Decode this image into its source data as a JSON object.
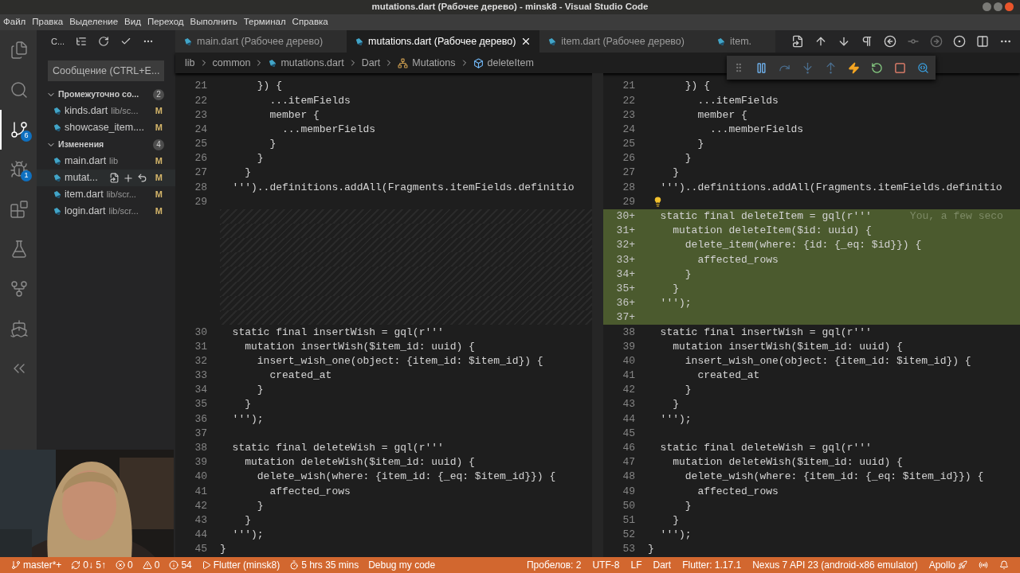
{
  "window": {
    "title": "mutations.dart (Рабочее дерево) - minsk8 - Visual Studio Code"
  },
  "menu": [
    "Файл",
    "Правка",
    "Выделение",
    "Вид",
    "Переход",
    "Выполнить",
    "Терминал",
    "Справка"
  ],
  "activity_bar": [
    {
      "kind": "files",
      "selected": false
    },
    {
      "kind": "search",
      "selected": false
    },
    {
      "kind": "scm",
      "selected": true,
      "badge": "6"
    },
    {
      "kind": "debug",
      "selected": false,
      "badge": "1"
    },
    {
      "kind": "extensions",
      "selected": false
    },
    {
      "kind": "flask",
      "selected": false
    },
    {
      "kind": "graph",
      "selected": false
    },
    {
      "kind": "docker",
      "selected": false
    },
    {
      "kind": "flutter",
      "selected": false
    }
  ],
  "sidebar": {
    "title": "С...",
    "message": {
      "placeholder": "Сообщение (CTRL+E..."
    },
    "groups": [
      {
        "label": "Промежуточно со...",
        "count": "2",
        "expanded": true,
        "files": [
          {
            "name": "kinds.dart",
            "path": "lib/sc...",
            "status": "M",
            "hovered": false
          },
          {
            "name": "showcase_item....",
            "status": "M",
            "hovered": false
          }
        ]
      },
      {
        "label": "Изменения",
        "count": "4",
        "expanded": true,
        "files": [
          {
            "name": "main.dart",
            "path": "lib",
            "status": "M",
            "hovered": false
          },
          {
            "name": "mutat...",
            "status": "M",
            "hovered": true
          },
          {
            "name": "item.dart",
            "path": "lib/scr...",
            "status": "M",
            "hovered": false
          },
          {
            "name": "login.dart",
            "path": "lib/scr...",
            "status": "M",
            "hovered": false
          }
        ]
      }
    ]
  },
  "tabs": [
    {
      "label": "main.dart (Рабочее дерево)",
      "selected": false
    },
    {
      "label": "mutations.dart (Рабочее дерево)",
      "selected": true
    },
    {
      "label": "item.dart (Рабочее дерево)",
      "selected": false
    },
    {
      "label": "item.",
      "selected": false
    }
  ],
  "breadcrumbs": [
    "lib",
    "common",
    "mutations.dart",
    "Dart",
    "Mutations",
    "deleteItem"
  ],
  "left_pane": [
    {
      "kind": "normal",
      "num": "21",
      "text": "      }) {"
    },
    {
      "kind": "normal",
      "num": "22",
      "text": "        ...itemFields"
    },
    {
      "kind": "normal",
      "num": "23",
      "text": "        member {"
    },
    {
      "kind": "normal",
      "num": "24",
      "text": "          ...memberFields"
    },
    {
      "kind": "normal",
      "num": "25",
      "text": "        }"
    },
    {
      "kind": "normal",
      "num": "26",
      "text": "      }"
    },
    {
      "kind": "normal",
      "num": "27",
      "text": "    }"
    },
    {
      "kind": "normal",
      "num": "28",
      "text": "  ''')..definitions.addAll(Fragments.itemFields.definitio"
    },
    {
      "kind": "normal",
      "num": "29"
    },
    {
      "kind": "filler"
    },
    {
      "kind": "filler"
    },
    {
      "kind": "filler"
    },
    {
      "kind": "filler"
    },
    {
      "kind": "filler"
    },
    {
      "kind": "filler"
    },
    {
      "kind": "filler"
    },
    {
      "kind": "filler"
    },
    {
      "kind": "normal",
      "num": "30",
      "text": "  static final insertWish = gql(r'''"
    },
    {
      "kind": "normal",
      "num": "31",
      "text": "    mutation insertWish($item_id: uuid) {"
    },
    {
      "kind": "normal",
      "num": "32",
      "text": "      insert_wish_one(object: {item_id: $item_id}) {"
    },
    {
      "kind": "normal",
      "num": "33",
      "text": "        created_at"
    },
    {
      "kind": "normal",
      "num": "34",
      "text": "      }"
    },
    {
      "kind": "normal",
      "num": "35",
      "text": "    }"
    },
    {
      "kind": "normal",
      "num": "36",
      "text": "  ''');"
    },
    {
      "kind": "normal",
      "num": "37"
    },
    {
      "kind": "normal",
      "num": "38",
      "text": "  static final deleteWish = gql(r'''"
    },
    {
      "kind": "normal",
      "num": "39",
      "text": "    mutation deleteWish($item_id: uuid) {"
    },
    {
      "kind": "normal",
      "num": "40",
      "text": "      delete_wish(where: {item_id: {_eq: $item_id}}) {"
    },
    {
      "kind": "normal",
      "num": "41",
      "text": "        affected_rows"
    },
    {
      "kind": "normal",
      "num": "42",
      "text": "      }"
    },
    {
      "kind": "normal",
      "num": "43",
      "text": "    }"
    },
    {
      "kind": "normal",
      "num": "44",
      "text": "  ''');"
    },
    {
      "kind": "normal",
      "num": "45",
      "text": "}"
    }
  ],
  "right_pane": [
    {
      "kind": "normal",
      "num": "21",
      "text": "      }) {"
    },
    {
      "kind": "normal",
      "num": "22",
      "text": "        ...itemFields"
    },
    {
      "kind": "normal",
      "num": "23",
      "text": "        member {"
    },
    {
      "kind": "normal",
      "num": "24",
      "text": "          ...memberFields"
    },
    {
      "kind": "normal",
      "num": "25",
      "text": "        }"
    },
    {
      "kind": "normal",
      "num": "26",
      "text": "      }"
    },
    {
      "kind": "normal",
      "num": "27",
      "text": "    }"
    },
    {
      "kind": "normal",
      "num": "28",
      "text": "  ''')..definitions.addAll(Fragments.itemFields.definitio"
    },
    {
      "kind": "normal",
      "num": "29",
      "lightbulb": true
    },
    {
      "kind": "added",
      "num": "30+",
      "text": "  static final deleteItem = gql(r'''",
      "blame": "You, a few seco"
    },
    {
      "kind": "added",
      "num": "31+",
      "text": "    mutation deleteItem($id: uuid) {"
    },
    {
      "kind": "added",
      "num": "32+",
      "text": "      delete_item(where: {id: {_eq: $id}}) {"
    },
    {
      "kind": "added",
      "num": "33+",
      "text": "        affected_rows"
    },
    {
      "kind": "added",
      "num": "34+",
      "text": "      }"
    },
    {
      "kind": "added",
      "num": "35+",
      "text": "    }"
    },
    {
      "kind": "added",
      "num": "36+",
      "text": "  ''');"
    },
    {
      "kind": "added",
      "num": "37+"
    },
    {
      "kind": "normal",
      "num": "38",
      "text": "  static final insertWish = gql(r'''"
    },
    {
      "kind": "normal",
      "num": "39",
      "text": "    mutation insertWish($item_id: uuid) {"
    },
    {
      "kind": "normal",
      "num": "40",
      "text": "      insert_wish_one(object: {item_id: $item_id}) {"
    },
    {
      "kind": "normal",
      "num": "41",
      "text": "        created_at"
    },
    {
      "kind": "normal",
      "num": "42",
      "text": "      }"
    },
    {
      "kind": "normal",
      "num": "43",
      "text": "    }"
    },
    {
      "kind": "normal",
      "num": "44",
      "text": "  ''');"
    },
    {
      "kind": "normal",
      "num": "45"
    },
    {
      "kind": "normal",
      "num": "46",
      "text": "  static final deleteWish = gql(r'''"
    },
    {
      "kind": "normal",
      "num": "47",
      "text": "    mutation deleteWish($item_id: uuid) {"
    },
    {
      "kind": "normal",
      "num": "48",
      "text": "      delete_wish(where: {item_id: {_eq: $item_id}}) {"
    },
    {
      "kind": "normal",
      "num": "49",
      "text": "        affected_rows"
    },
    {
      "kind": "normal",
      "num": "50",
      "text": "      }"
    },
    {
      "kind": "normal",
      "num": "51",
      "text": "    }"
    },
    {
      "kind": "normal",
      "num": "52",
      "text": "  ''');"
    },
    {
      "kind": "normal",
      "num": "53",
      "text": "}"
    }
  ],
  "status_bar": {
    "left": [
      {
        "kind": "branch",
        "text": "master*+"
      },
      {
        "kind": "sync",
        "text": "0↓ 5↑"
      },
      {
        "kind": "errors",
        "text": "0"
      },
      {
        "kind": "warnings",
        "text": "0"
      },
      {
        "kind": "info",
        "text": "54"
      },
      {
        "kind": "run",
        "text": "Flutter (minsk8)"
      },
      {
        "kind": "time",
        "text": "5 hrs 35 mins"
      },
      {
        "kind": "plain",
        "text": "Debug my code"
      }
    ],
    "right": [
      {
        "kind": "plain",
        "text": "Пробелов: 2"
      },
      {
        "kind": "plain",
        "text": "UTF-8"
      },
      {
        "kind": "plain",
        "text": "LF"
      },
      {
        "kind": "plain",
        "text": "Dart"
      },
      {
        "kind": "plain",
        "text": "Flutter: 1.17.1"
      },
      {
        "kind": "plain",
        "text": "Nexus 7 API 23 (android-x86 emulator)"
      },
      {
        "kind": "apollo",
        "text": "Apollo"
      },
      {
        "kind": "broadcast"
      },
      {
        "kind": "bell"
      }
    ]
  },
  "webcam": {
    "kind": "picture"
  }
}
